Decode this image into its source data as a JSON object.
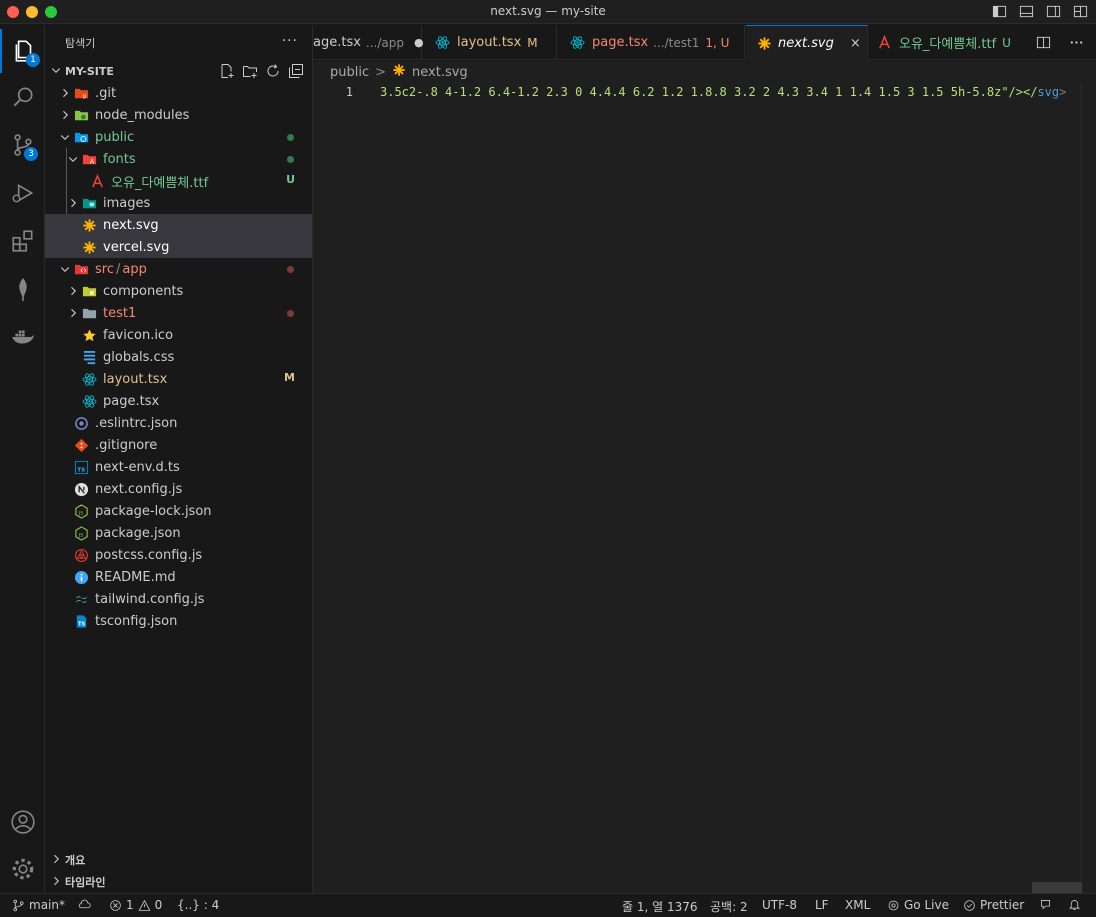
{
  "window": {
    "title": "next.svg — my-site"
  },
  "activity": {
    "explorer_badge": "1",
    "scm_badge": "3"
  },
  "sidebar": {
    "header": "탐색기",
    "more": "···",
    "section": "MY-SITE",
    "tree": [
      {
        "label": ".git",
        "indent": 1,
        "chevron": "right",
        "icon": "folder-git-icon",
        "color": "#cccccc"
      },
      {
        "label": "node_modules",
        "indent": 1,
        "chevron": "right",
        "icon": "folder-node-icon",
        "color": "#cccccc"
      },
      {
        "label": "public",
        "indent": 1,
        "chevron": "down",
        "icon": "folder-public-icon",
        "color": "#73c991",
        "dot": "#2e7d4a"
      },
      {
        "label": "fonts",
        "indent": 2,
        "chevron": "down",
        "icon": "folder-fonts-icon",
        "color": "#73c991",
        "dot": "#2e7d4a"
      },
      {
        "label": "오유_다예쁨체.ttf",
        "indent": 3,
        "chevron": "",
        "icon": "font-file-icon",
        "color": "#73c991",
        "decor": "U",
        "decor_color": "#73c991"
      },
      {
        "label": "images",
        "indent": 2,
        "chevron": "right",
        "icon": "folder-images-icon",
        "color": "#cccccc"
      },
      {
        "label": "next.svg",
        "indent": 2,
        "chevron": "",
        "icon": "svg-file-icon",
        "color": "#ffffff",
        "selected": true
      },
      {
        "label": "vercel.svg",
        "indent": 2,
        "chevron": "",
        "icon": "svg-file-icon",
        "color": "#ffffff",
        "selected": true
      },
      {
        "label": "src",
        "label2": "app",
        "indent": 1,
        "chevron": "down",
        "icon": "folder-src-icon",
        "color": "#f48771",
        "dot": "#7a3b3b"
      },
      {
        "label": "components",
        "indent": 2,
        "chevron": "right",
        "icon": "folder-components-icon",
        "color": "#cccccc"
      },
      {
        "label": "test1",
        "indent": 2,
        "chevron": "right",
        "icon": "folder-plain-icon",
        "color": "#f48771",
        "dot": "#7a3b3b"
      },
      {
        "label": "favicon.ico",
        "indent": 2,
        "chevron": "",
        "icon": "favicon-star-icon",
        "color": "#cccccc"
      },
      {
        "label": "globals.css",
        "indent": 2,
        "chevron": "",
        "icon": "css-file-icon",
        "color": "#cccccc"
      },
      {
        "label": "layout.tsx",
        "indent": 2,
        "chevron": "",
        "icon": "react-icon",
        "color": "#e2c08d",
        "decor": "M",
        "decor_color": "#e2c08d"
      },
      {
        "label": "page.tsx",
        "indent": 2,
        "chevron": "",
        "icon": "react-icon",
        "color": "#cccccc"
      },
      {
        "label": ".eslintrc.json",
        "indent": 1,
        "chevron": "",
        "icon": "eslint-icon",
        "color": "#cccccc"
      },
      {
        "label": ".gitignore",
        "indent": 1,
        "chevron": "",
        "icon": "git-file-icon",
        "color": "#cccccc"
      },
      {
        "label": "next-env.d.ts",
        "indent": 1,
        "chevron": "",
        "icon": "ts-file-icon",
        "color": "#cccccc"
      },
      {
        "label": "next.config.js",
        "indent": 1,
        "chevron": "",
        "icon": "next-logo-icon",
        "color": "#cccccc"
      },
      {
        "label": "package-lock.json",
        "indent": 1,
        "chevron": "",
        "icon": "npm-json-icon",
        "color": "#cccccc"
      },
      {
        "label": "package.json",
        "indent": 1,
        "chevron": "",
        "icon": "npm-json-icon",
        "color": "#cccccc"
      },
      {
        "label": "postcss.config.js",
        "indent": 1,
        "chevron": "",
        "icon": "postcss-icon",
        "color": "#cccccc"
      },
      {
        "label": "README.md",
        "indent": 1,
        "chevron": "",
        "icon": "info-icon",
        "color": "#cccccc"
      },
      {
        "label": "tailwind.config.js",
        "indent": 1,
        "chevron": "",
        "icon": "tailwind-icon",
        "color": "#cccccc"
      },
      {
        "label": "tsconfig.json",
        "indent": 1,
        "chevron": "",
        "icon": "tsconfig-icon",
        "color": "#cccccc"
      }
    ],
    "bottom": [
      {
        "label": "개요"
      },
      {
        "label": "타임라인"
      }
    ]
  },
  "tabs": [
    {
      "label": "age.tsx",
      "path": ".../app",
      "marker": "●",
      "icon": "none",
      "color": "#cccccc"
    },
    {
      "label": "layout.tsx",
      "path": "",
      "marker": "M",
      "icon": "react-icon",
      "color": "#e2c08d"
    },
    {
      "label": "page.tsx",
      "path": ".../test1",
      "marker": "1, U",
      "icon": "react-icon",
      "color": "#f48771"
    },
    {
      "label": "next.svg",
      "path": "",
      "marker": "×",
      "icon": "svg-file-icon",
      "color": "#ffffff",
      "active": true
    },
    {
      "label": "오유_다예쁨체.ttf",
      "path": "",
      "marker": "U",
      "icon": "font-file-icon",
      "color": "#73c991"
    }
  ],
  "breadcrumb": {
    "folder": "public",
    "sep": ">",
    "file": "next.svg"
  },
  "editor": {
    "line_number": "1",
    "code_text": "3.5c2-.8 4-1.2 6.4-1.2 2.3 0 4.4.4 6.2 1.2 1.8.8 3.2 2 4.3 3.4 1 1.4 1.5 3 1.5 5h-5.8z\"/></",
    "code_tag": "svg",
    "code_end": ">"
  },
  "status": {
    "branch": "main*",
    "errors": "1",
    "warnings": "0",
    "braces": "{..} : 4",
    "cursor": "줄 1, 열 1376",
    "spaces": "공백: 2",
    "encoding": "UTF-8",
    "eol": "LF",
    "language": "XML",
    "golive": "Go Live",
    "prettier": "Prettier"
  }
}
